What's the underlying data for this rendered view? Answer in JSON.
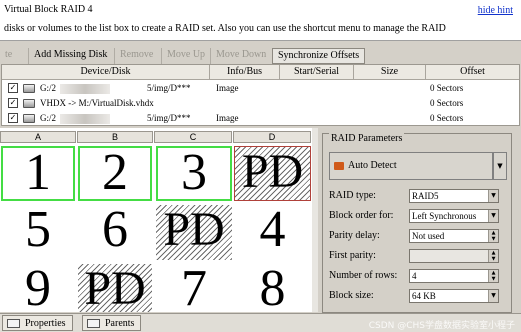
{
  "header": {
    "title": "Virtual Block RAID 4",
    "hint": "hide hint",
    "description": "disks or volumes to the list box to create a RAID set. Also you can use the shortcut menu to manage the RAID"
  },
  "toolbar": {
    "buttons": [
      {
        "label": "te",
        "disabled": true
      },
      {
        "label": "Add Missing Disk",
        "disabled": false
      },
      {
        "label": "Remove",
        "disabled": true
      },
      {
        "label": "Move Up",
        "disabled": true
      },
      {
        "label": "Move Down",
        "disabled": true
      },
      {
        "label": "Synchronize Offsets",
        "disabled": false
      }
    ]
  },
  "table": {
    "columns": [
      "Device/Disk",
      "Info/Bus",
      "Start/Serial",
      "Size",
      "Offset"
    ],
    "rows": [
      {
        "device": "G:/2",
        "device_tail": "5/img/D***",
        "info": "Image",
        "offset": "0 Sectors"
      },
      {
        "device": "VHDX -> M:/VirtualDisk.vhdx",
        "device_tail": "",
        "info": "",
        "offset": "0 Sectors"
      },
      {
        "device": "G:/2",
        "device_tail": "5/img/D***",
        "info": "Image",
        "offset": "0 Sectors"
      }
    ]
  },
  "grid": {
    "columns": [
      "A",
      "B",
      "C",
      "D"
    ],
    "rows": [
      [
        "1",
        "2",
        "3",
        "PD"
      ],
      [
        "5",
        "6",
        "PD",
        "4"
      ],
      [
        "9",
        "PD",
        "7",
        "8"
      ]
    ]
  },
  "raid": {
    "title": "RAID Parameters",
    "auto_detect": "Auto Detect",
    "params": [
      {
        "label": "RAID type:",
        "value": "RAID5",
        "kind": "select"
      },
      {
        "label": "Block order for:",
        "value": "Left Synchronous",
        "kind": "select"
      },
      {
        "label": "Parity delay:",
        "value": "Not used",
        "kind": "spin"
      },
      {
        "label": "First parity:",
        "value": "",
        "kind": "spin-disabled"
      },
      {
        "label": "Number of rows:",
        "value": "4",
        "kind": "spin"
      },
      {
        "label": "Block size:",
        "value": "64 KB",
        "kind": "select"
      }
    ]
  },
  "bottom": {
    "tabs": [
      "Properties",
      "Parents"
    ],
    "watermark": "CSDN @CHS学盘数据实验室小程子"
  },
  "colors": {
    "green_border": "#44dd44",
    "red_border": "#b0413a",
    "link": "#1133cc"
  }
}
